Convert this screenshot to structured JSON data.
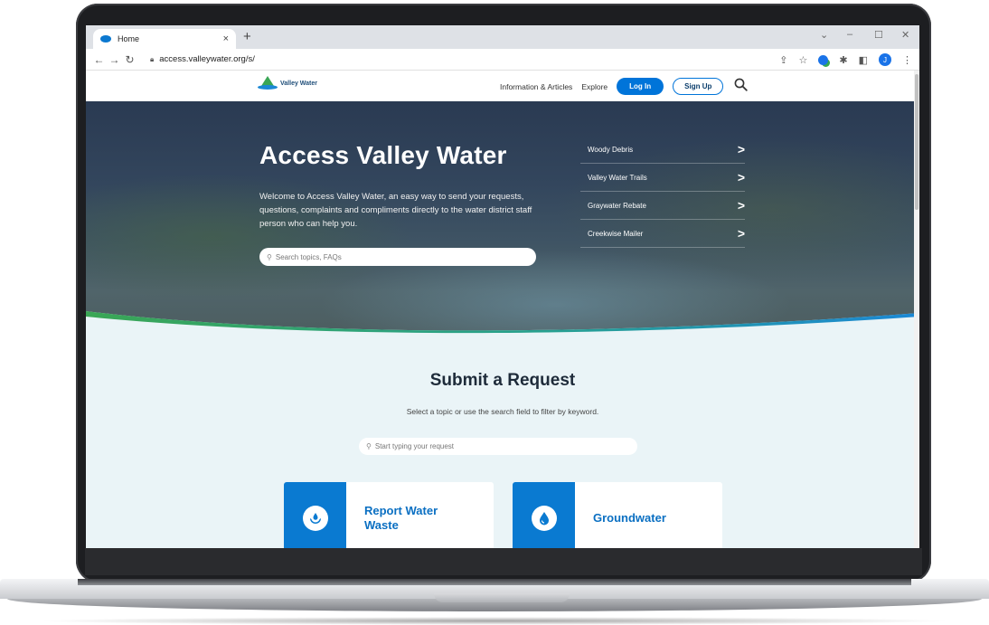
{
  "browser": {
    "tab_title": "Home",
    "tab_close": "×",
    "new_tab": "+",
    "url": "access.valleywater.org/s/",
    "profile_initial": "J"
  },
  "site": {
    "logo_text": "Valley Water",
    "nav": {
      "info_label": "Information & Articles",
      "explore_label": "Explore",
      "login_label": "Log In",
      "signup_label": "Sign Up"
    }
  },
  "hero": {
    "title": "Access Valley Water",
    "description": "Welcome to Access Valley Water, an easy way to send your requests, questions, complaints and compliments directly to the water district staff person who can help you.",
    "search_placeholder": "Search topics, FAQs",
    "quick_links": [
      {
        "label": "Woody Debris"
      },
      {
        "label": "Valley Water Trails"
      },
      {
        "label": "Graywater Rebate"
      },
      {
        "label": "Creekwise Mailer"
      }
    ]
  },
  "request": {
    "title": "Submit a Request",
    "subtitle": "Select a topic or use the search field to filter by keyword.",
    "search_placeholder": "Start typing your request",
    "cards": [
      {
        "label": "Report Water Waste",
        "icon": "hands-water-drop-icon"
      },
      {
        "label": "Groundwater",
        "icon": "water-drop-icon"
      }
    ]
  },
  "colors": {
    "primary_blue": "#0074d9",
    "wave_green": "#3aa655",
    "request_bg": "#eaf4f7"
  }
}
